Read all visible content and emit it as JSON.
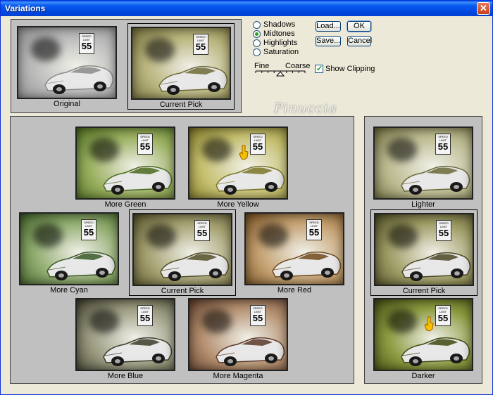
{
  "window": {
    "title": "Variations",
    "close_glyph": "✕"
  },
  "watermark": "Pinuccia",
  "sign": {
    "top": "SPEED\nLIMIT",
    "number": "55"
  },
  "top_panel": [
    {
      "caption": "Original",
      "tint": "#8a8a8a",
      "bg": "#b9b9b9",
      "selected": false
    },
    {
      "caption": "Current Pick",
      "tint": "#6f6a38",
      "bg": "#b8b47c",
      "selected": true
    }
  ],
  "tone_options": [
    {
      "label": "Shadows",
      "checked": false
    },
    {
      "label": "Midtones",
      "checked": true
    },
    {
      "label": "Highlights",
      "checked": false
    },
    {
      "label": "Saturation",
      "checked": false
    }
  ],
  "slider": {
    "fine_label": "Fine",
    "coarse_label": "Coarse",
    "position_fraction": 0.5
  },
  "buttons": {
    "load": "Load...",
    "ok": "OK",
    "save": "Save...",
    "cancel": "Cancel"
  },
  "show_clipping": {
    "label": "Show Clipping",
    "checked": true
  },
  "variations": [
    {
      "caption": "More Green",
      "tint": "#4a6a1c",
      "bg": "#9ab060",
      "selected": false,
      "cursor": false
    },
    {
      "caption": "More Yellow",
      "tint": "#7a7424",
      "bg": "#c6c070",
      "selected": false,
      "cursor": true
    },
    {
      "caption": "More Cyan",
      "tint": "#3a5a26",
      "bg": "#8eaa6c",
      "selected": false,
      "cursor": false
    },
    {
      "caption": "Current Pick",
      "tint": "#545028",
      "bg": "#a4a070",
      "selected": true,
      "cursor": false
    },
    {
      "caption": "More Red",
      "tint": "#6e4a1c",
      "bg": "#c4a070",
      "selected": false,
      "cursor": false
    },
    {
      "caption": "More Blue",
      "tint": "#3c3c2a",
      "bg": "#9a9a80",
      "selected": false,
      "cursor": false
    },
    {
      "caption": "More Magenta",
      "tint": "#5c3a28",
      "bg": "#b49070",
      "selected": false,
      "cursor": false
    }
  ],
  "brightness": [
    {
      "caption": "Lighter",
      "tint": "#6a6838",
      "bg": "#bcba90",
      "selected": false,
      "cursor": false
    },
    {
      "caption": "Current Pick",
      "tint": "#4a4822",
      "bg": "#9e9c64",
      "selected": true,
      "cursor": false
    },
    {
      "caption": "Darker",
      "tint": "#3e4a10",
      "bg": "#8c9a40",
      "selected": false,
      "cursor": true
    }
  ]
}
